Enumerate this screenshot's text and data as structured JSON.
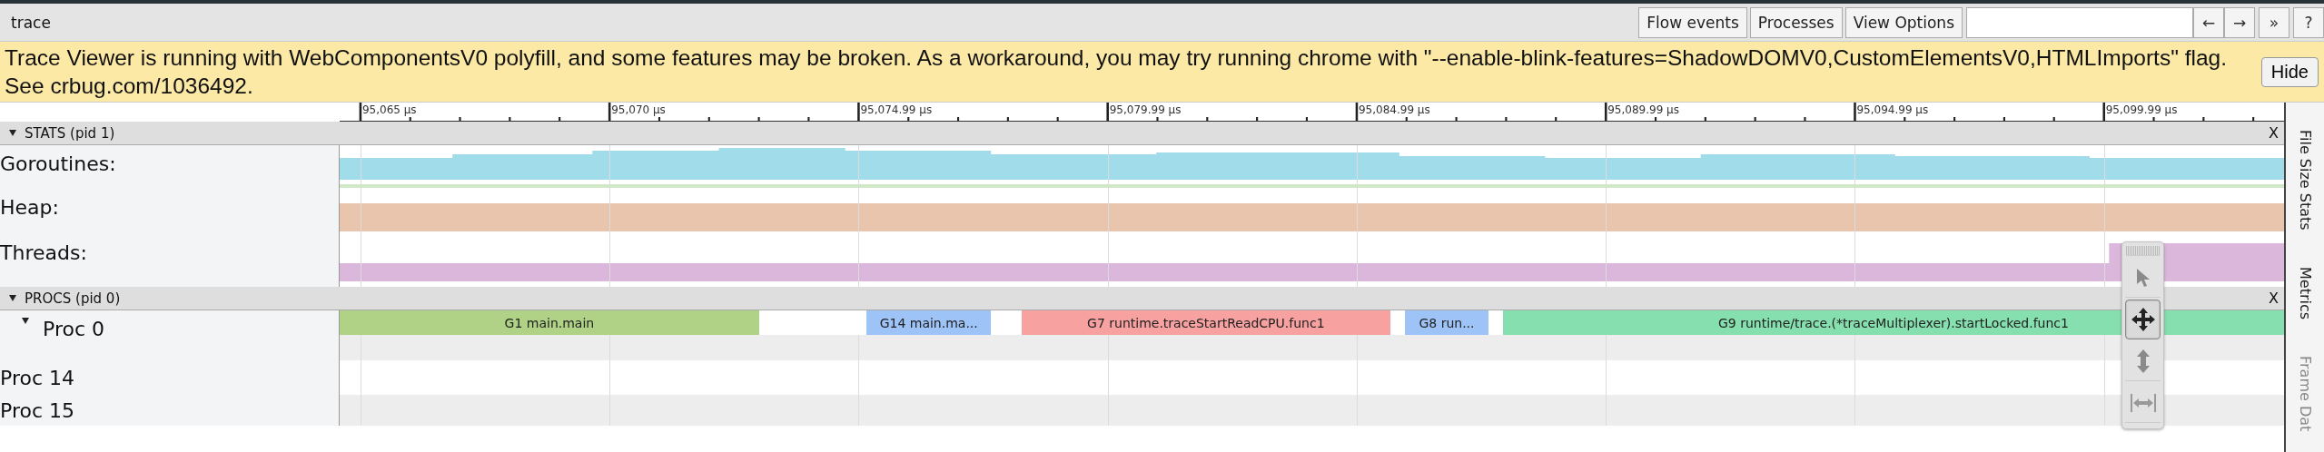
{
  "window": {
    "title": "trace"
  },
  "toolbar": {
    "buttons": [
      {
        "label": "Flow events"
      },
      {
        "label": "Processes"
      },
      {
        "label": "View Options"
      }
    ],
    "nav_buttons": [
      "←",
      "→",
      "»",
      "?"
    ]
  },
  "banner": {
    "message": "Trace Viewer is running with WebComponentsV0 polyfill, and some features may be broken. As a workaround, you may try running chrome with \"--enable-blink-features=ShadowDOMV0,CustomElementsV0,HTMLImports\" flag. See crbug.com/1036492.",
    "button": "Hide"
  },
  "ruler": {
    "labels": [
      "95,065 µs",
      "95,070 µs",
      "95,074.99 µs",
      "95,079.99 µs",
      "95,084.99 µs",
      "95,089.99 µs",
      "95,094.99 µs",
      "95,099.99 µs"
    ]
  },
  "stats": {
    "title": "STATS (pid 1)",
    "expanded": true,
    "close": "X",
    "counters": [
      {
        "label": "Goroutines:",
        "kind": "goroutines"
      },
      {
        "label": "Heap:",
        "kind": "heap"
      },
      {
        "label": "Threads:",
        "kind": "threads"
      }
    ]
  },
  "procs": {
    "title": "PROCS (pid 0)",
    "expanded": true,
    "close": "X",
    "threads": [
      {
        "label": "Proc 0",
        "expanded": true,
        "slices": [
          {
            "label": "G1 main.main",
            "color": "#b0d286"
          },
          {
            "label": "G14 main.ma...",
            "color": "#9ec3f7"
          },
          {
            "label": "G7 runtime.traceStartReadCPU.func1",
            "color": "#f7a1a1"
          },
          {
            "label": "G8 run...",
            "color": "#9ec3f7"
          },
          {
            "label": "G9 runtime/trace.(*traceMultiplexer).startLocked.func1",
            "color": "#86dfae"
          }
        ]
      },
      {
        "label": "Proc 14"
      },
      {
        "label": "Proc 15"
      }
    ]
  },
  "mouse_modes": [
    {
      "kind": "select",
      "selected": false
    },
    {
      "kind": "pan",
      "selected": true
    },
    {
      "kind": "zoom",
      "selected": false
    },
    {
      "kind": "timing",
      "selected": false
    }
  ],
  "side_tabs": [
    {
      "label": "File Size Stats",
      "disabled": false
    },
    {
      "label": "Metrics",
      "disabled": false
    },
    {
      "label": "Frame Dat",
      "disabled": true
    }
  ]
}
